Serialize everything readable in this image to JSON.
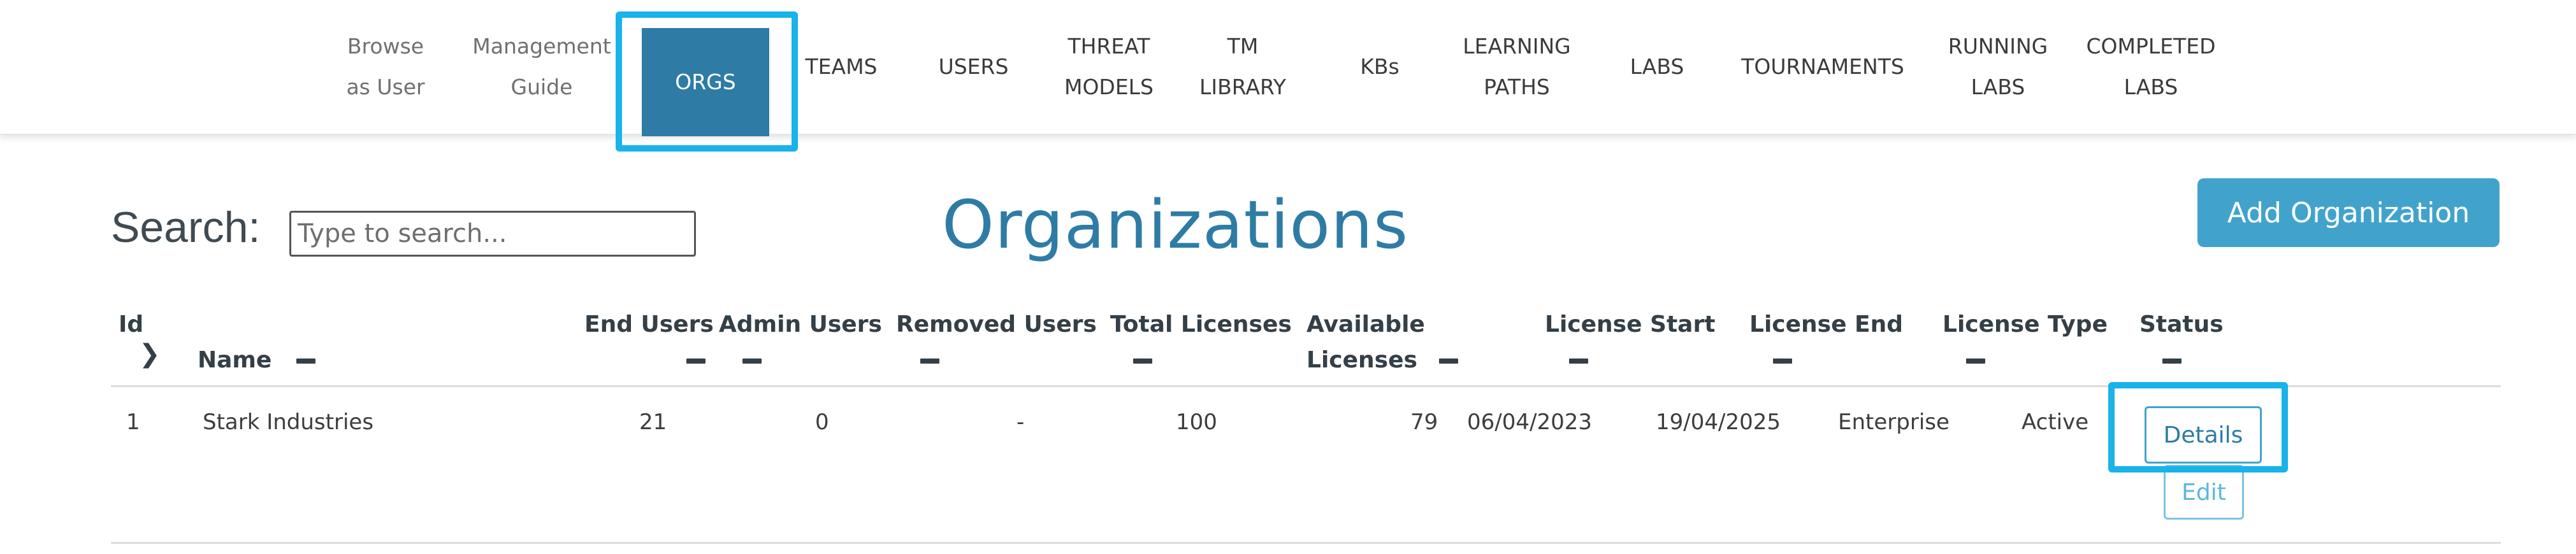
{
  "nav": {
    "items": [
      {
        "label": "Browse\nas User"
      },
      {
        "label": "Management\nGuide"
      },
      {
        "label": "ORGS"
      },
      {
        "label": "TEAMS"
      },
      {
        "label": "USERS"
      },
      {
        "label": "THREAT\nMODELS"
      },
      {
        "label": "TM\nLIBRARY"
      },
      {
        "label": "KBs"
      },
      {
        "label": "LEARNING\nPATHS"
      },
      {
        "label": "LABS"
      },
      {
        "label": "TOURNAMENTS"
      },
      {
        "label": "RUNNING\nLABS"
      },
      {
        "label": "COMPLETED\nLABS"
      }
    ],
    "active": "ORGS"
  },
  "search": {
    "label": "Search:",
    "placeholder": "Type to search..."
  },
  "page_title": "Organizations",
  "add_button": "Add Organization",
  "table": {
    "headers": {
      "id": "Id",
      "name": "Name",
      "end_users": "End Users",
      "admin_users": "Admin Users",
      "removed_users": "Removed Users",
      "total_licenses": "Total Licenses",
      "available_licenses_1": "Available",
      "available_licenses_2": "Licenses",
      "license_start": "License Start",
      "license_end": "License End",
      "license_type": "License Type",
      "status": "Status"
    },
    "rows": [
      {
        "id": "1",
        "name": "Stark Industries",
        "end_users": "21",
        "admin_users": "0",
        "removed_users": "-",
        "total_licenses": "100",
        "available_licenses": "79",
        "license_start": "06/04/2023",
        "license_end": "19/04/2025",
        "license_type": "Enterprise",
        "status": "Active",
        "details_label": "Details",
        "edit_label": "Edit"
      }
    ]
  },
  "colors": {
    "accent": "#2e7ca5",
    "button": "#41a3cc",
    "highlight": "#19b3ea"
  }
}
